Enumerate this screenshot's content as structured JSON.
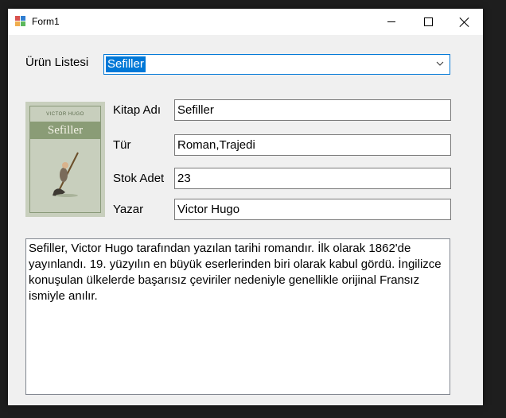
{
  "window": {
    "title": "Form1"
  },
  "titlebar": {
    "app_icon": "form-icon",
    "minimize_icon": "minimize-icon",
    "maximize_icon": "maximize-icon",
    "close_icon": "close-icon"
  },
  "product_list": {
    "label": "Ürün Listesi",
    "selected": "Sefiller",
    "dropdown_icon": "chevron-down-icon"
  },
  "cover": {
    "author": "VICTOR HUGO",
    "title": "Sefiller"
  },
  "fields": {
    "book_name": {
      "label": "Kitap Adı",
      "value": "Sefiller"
    },
    "genre": {
      "label": "Tür",
      "value": "Roman,Trajedi"
    },
    "stock": {
      "label": "Stok Adet",
      "value": "23"
    },
    "author": {
      "label": "Yazar",
      "value": "Victor Hugo"
    }
  },
  "description": "Sefiller, Victor Hugo tarafından yazılan tarihi romandır. İlk olarak 1862'de yayınlandı. 19. yüzyılın en büyük eserlerinden biri olarak kabul gördü. İngilizce konuşulan ülkelerde başarısız çeviriler nedeniyle genellikle orijinal Fransız ismiyle anılır.",
  "colors": {
    "accent": "#0078d7",
    "window_bg": "#f0f0f0",
    "cover_bg": "#c8cfbd"
  }
}
